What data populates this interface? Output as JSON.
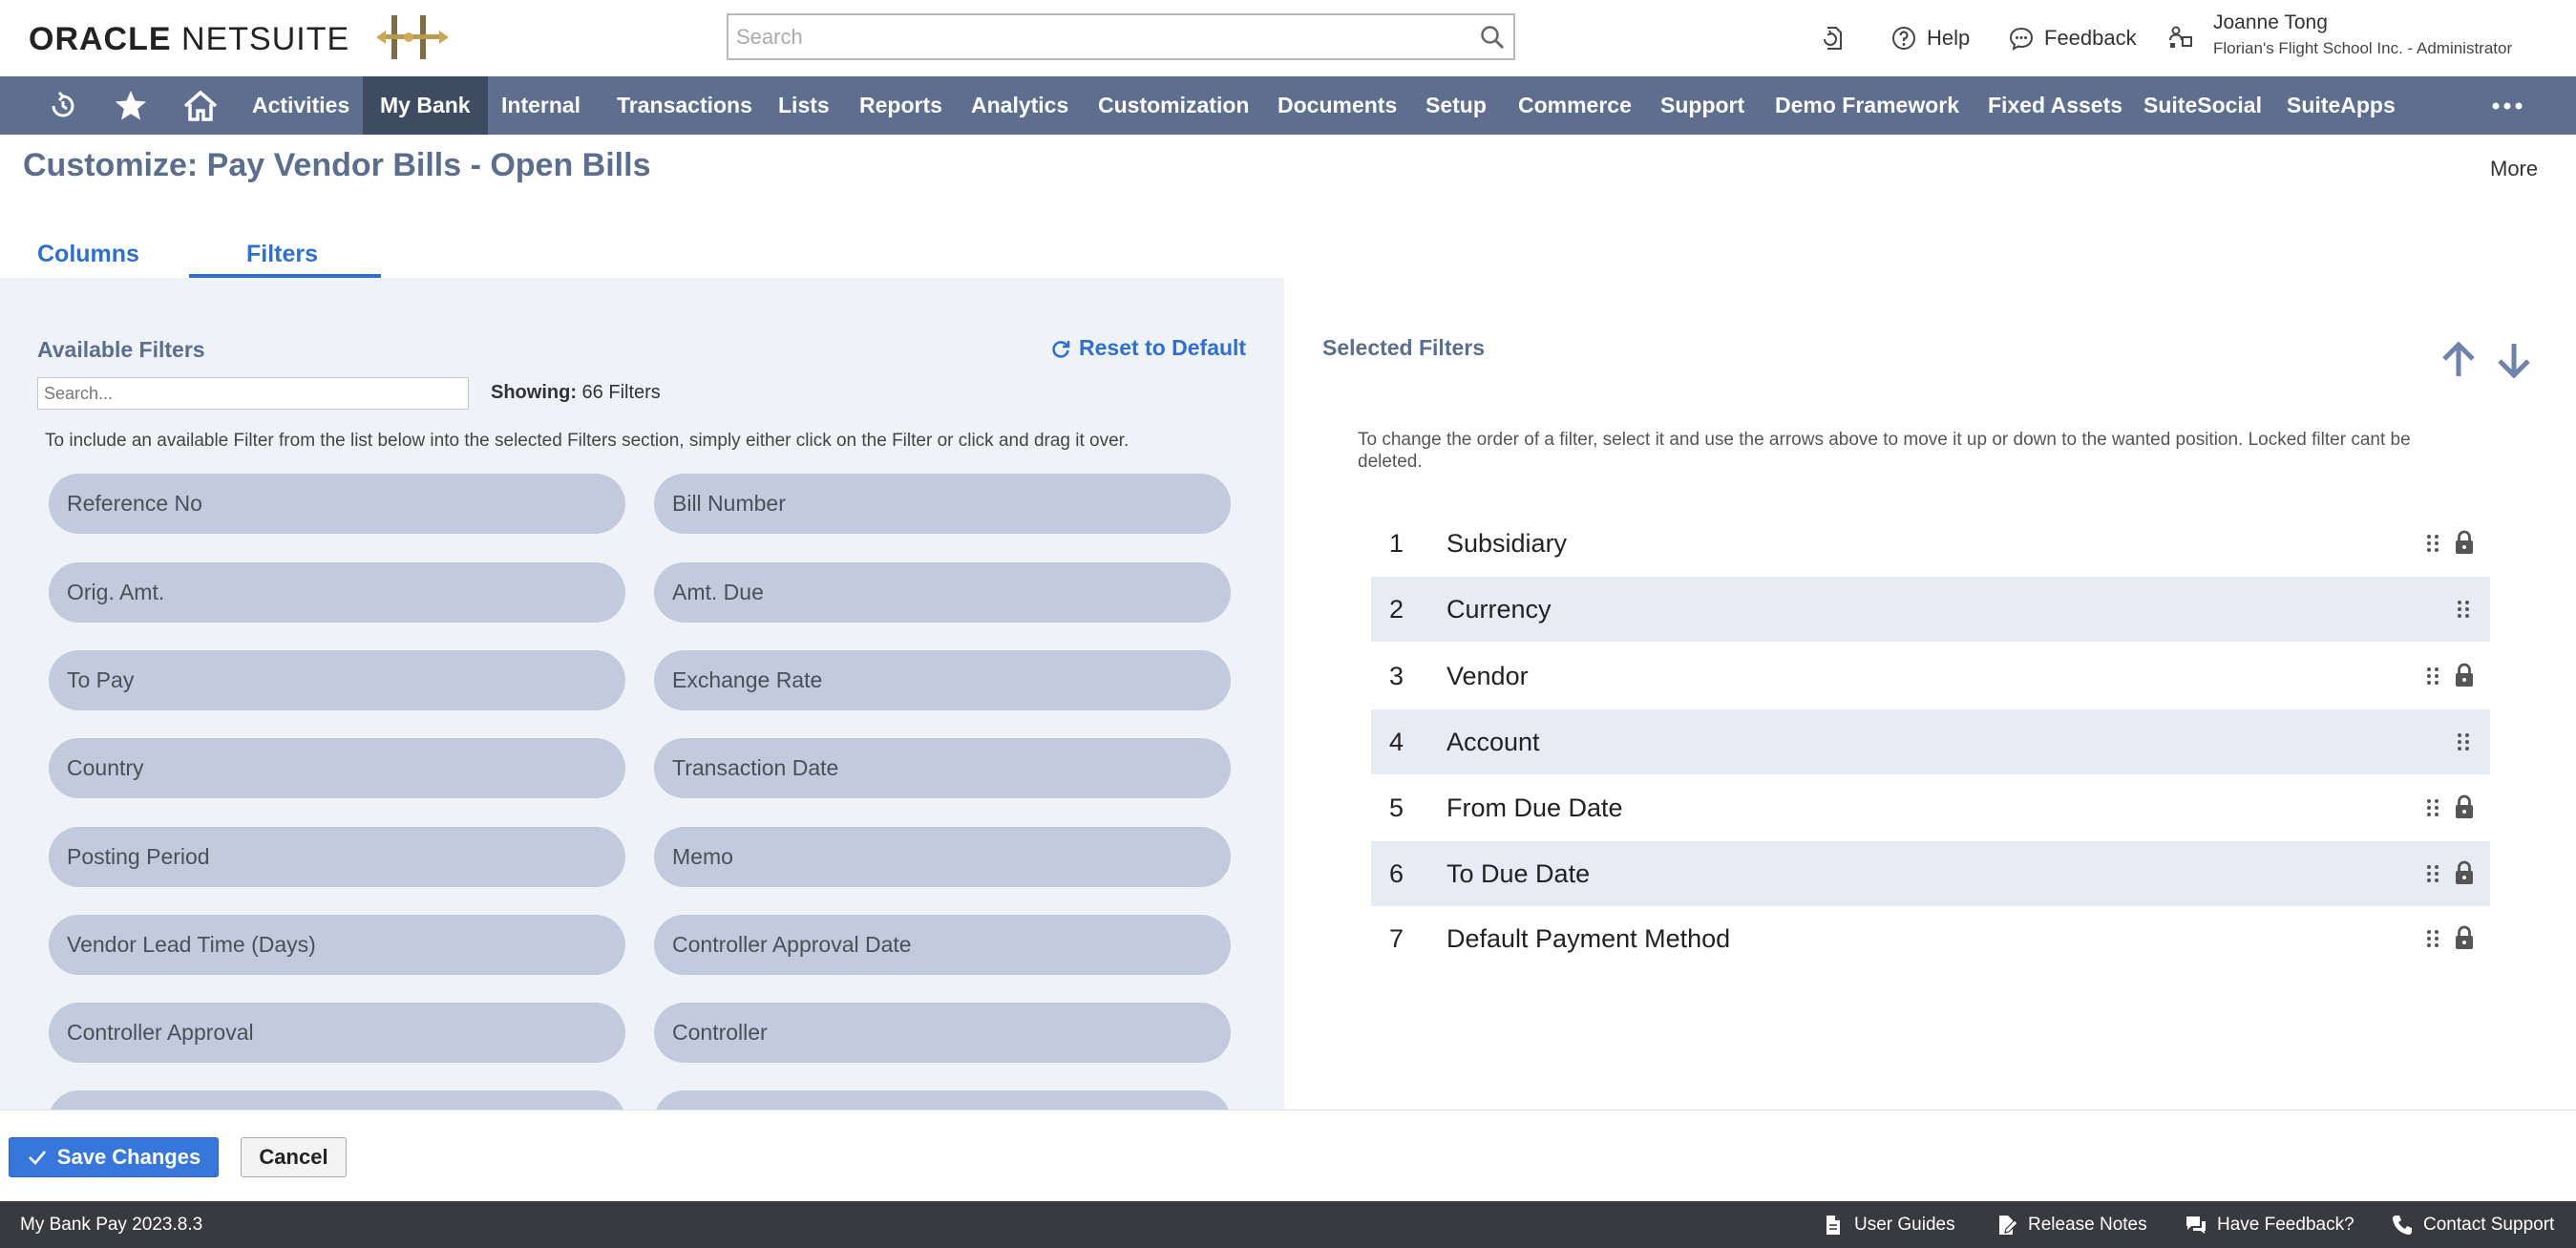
{
  "header": {
    "brand_oracle": "ORACLE",
    "brand_netsuite": "NETSUITE",
    "search_placeholder": "Search",
    "help_label": "Help",
    "feedback_label": "Feedback",
    "user_name": "Joanne Tong",
    "user_org_role": "Florian's Flight School Inc. - Administrator"
  },
  "nav": {
    "items": [
      "Activities",
      "My Bank",
      "Internal",
      "Transactions",
      "Lists",
      "Reports",
      "Analytics",
      "Customization",
      "Documents",
      "Setup",
      "Commerce",
      "Support",
      "Demo Framework",
      "Fixed Assets",
      "SuiteSocial",
      "SuiteApps"
    ],
    "active": "My Bank"
  },
  "page": {
    "title": "Customize: Pay Vendor Bills - Open Bills",
    "more_label": "More"
  },
  "tabs": [
    "Columns",
    "Filters"
  ],
  "available": {
    "title": "Available Filters",
    "reset_label": "Reset to Default",
    "search_placeholder": "Search...",
    "showing_label": "Showing:",
    "showing_value": "66 Filters",
    "instructions": "To include an available Filter from the list below into the selected Filters section, simply either click on the Filter or click and drag it over.",
    "filters": [
      "Reference No",
      "Bill Number",
      "Orig. Amt.",
      "Amt. Due",
      "To Pay",
      "Exchange Rate",
      "Country",
      "Transaction Date",
      "Posting Period",
      "Memo",
      "Vendor Lead Time (Days)",
      "Controller Approval Date",
      "Controller Approval",
      "Controller"
    ]
  },
  "selected": {
    "title": "Selected Filters",
    "instructions": "To change the order of a filter, select it and use the arrows above to move it up or down to the wanted position. Locked filter cant be deleted.",
    "items": [
      {
        "num": "1",
        "label": "Subsidiary"
      },
      {
        "num": "2",
        "label": "Currency"
      },
      {
        "num": "3",
        "label": "Vendor"
      },
      {
        "num": "4",
        "label": "Account"
      },
      {
        "num": "5",
        "label": "From Due Date"
      },
      {
        "num": "6",
        "label": "To Due Date"
      },
      {
        "num": "7",
        "label": "Default Payment Method"
      }
    ]
  },
  "actions": {
    "save_label": "Save Changes",
    "cancel_label": "Cancel"
  },
  "footer": {
    "version": "My Bank Pay 2023.8.3",
    "user_guides": "User Guides",
    "release_notes": "Release Notes",
    "have_feedback": "Have Feedback?",
    "contact_support": "Contact Support"
  },
  "colors": {
    "nav_bg": "#5d6e8f",
    "nav_active": "#3f4b61",
    "accent_blue": "#2f6fce",
    "pill_bg": "#c1cbdd",
    "footer_bg": "#383a3f"
  }
}
